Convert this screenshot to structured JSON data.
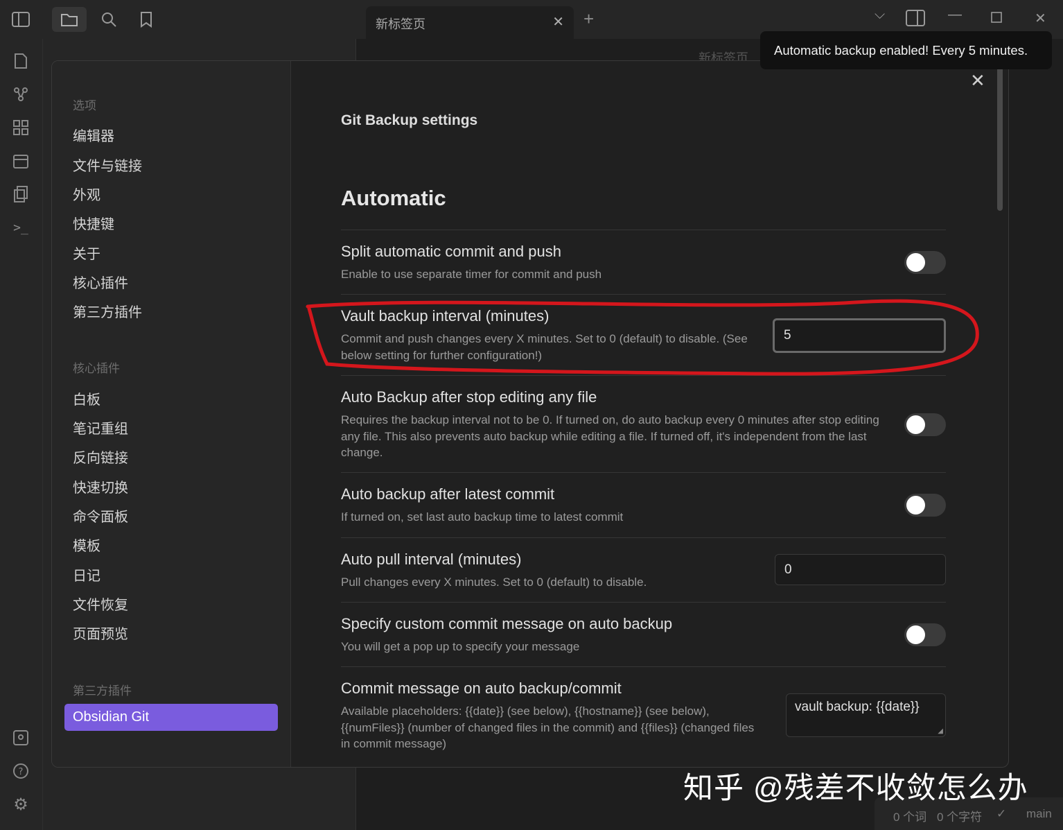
{
  "tab": {
    "title": "新标签页"
  },
  "editor_title_hint": "新标签页",
  "notice": "Automatic backup enabled! Every 5 minutes.",
  "nav": {
    "heading_options": "选项",
    "options": [
      "编辑器",
      "文件与链接",
      "外观",
      "快捷键",
      "关于",
      "核心插件",
      "第三方插件"
    ],
    "heading_core": "核心插件",
    "core": [
      "白板",
      "笔记重组",
      "反向链接",
      "快速切换",
      "命令面板",
      "模板",
      "日记",
      "文件恢复",
      "页面预览"
    ],
    "heading_community": "第三方插件",
    "community": [
      "Obsidian Git"
    ]
  },
  "page_title": "Git Backup settings",
  "section_heading": "Automatic",
  "settings": [
    {
      "name": "Split automatic commit and push",
      "desc": "Enable to use separate timer for commit and push",
      "control": "toggle",
      "on": false
    },
    {
      "name": "Vault backup interval (minutes)",
      "desc": "Commit and push changes every X minutes. Set to 0 (default) to disable. (See below setting for further configuration!)",
      "control": "text",
      "value": "5"
    },
    {
      "name": "Auto Backup after stop editing any file",
      "desc": "Requires the backup interval not to be 0. If turned on, do auto backup every 0 minutes after stop editing any file. This also prevents auto backup while editing a file. If turned off, it's independent from the last change.",
      "control": "toggle",
      "on": false
    },
    {
      "name": "Auto backup after latest commit",
      "desc": "If turned on, set last auto backup time to latest commit",
      "control": "toggle",
      "on": false
    },
    {
      "name": "Auto pull interval (minutes)",
      "desc": "Pull changes every X minutes. Set to 0 (default) to disable.",
      "control": "text",
      "value": "0"
    },
    {
      "name": "Specify custom commit message on auto backup",
      "desc": "You will get a pop up to specify your message",
      "control": "toggle",
      "on": false
    },
    {
      "name": "Commit message on auto backup/commit",
      "desc": "Available placeholders: {{date}} (see below), {{hostname}} (see below), {{numFiles}} (number of changed files in the commit) and {{files}} (changed files in commit message)",
      "control": "textarea",
      "value": "vault backup: {{date}}"
    }
  ],
  "watermark": "知乎 @残差不收敛怎么办",
  "status": {
    "words": "0 个词",
    "chars": "0 个字符",
    "branch": "main"
  },
  "colors": {
    "accent": "#7a5cde",
    "annotation": "#d4161c"
  }
}
